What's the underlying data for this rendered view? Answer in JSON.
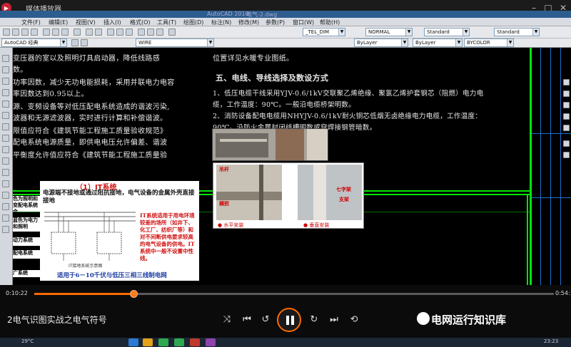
{
  "player": {
    "app_name": "媒体播放器",
    "video_title": "2电气识图实战之电气符号",
    "time_current": "0:10:22",
    "time_total": "0:54:17",
    "progress": 0.191,
    "watermark": "电网运行知识库"
  },
  "cad": {
    "app_title": "AutoCAD 2010",
    "doc_title": "电气-2.dwg",
    "menu": [
      "文件(F)",
      "编辑(E)",
      "视图(V)",
      "插入(I)",
      "格式(O)",
      "工具(T)",
      "绘图(D)",
      "标注(N)",
      "修改(M)",
      "参数(P)",
      "窗口(W)",
      "帮助(H)"
    ],
    "workspace": "AutoCAD 经典",
    "layer": "WIRE",
    "dimstyle": "_TEL_DIM",
    "style_normal": "NORMAL",
    "textstyle": "Standard",
    "tablestyle": "Standard",
    "linetype": "ByLayer",
    "lineweight": "ByLayer",
    "plotstyle": "BYCOLOR"
  },
  "drawing_text": {
    "left_lines": [
      "变压器的室以及照明灯具启动器，降低线路感",
      "数。",
      "功率因数，减少无功电能损耗，采用并联电力电容",
      "率因数达到0.95以上。",
      "源、变频设备等对低压配电系统造成的谐波污染,",
      "波器和无源滤波器，实时进行计算和补偿谐波。",
      "限值应符合《建筑节能工程施工质量验收规范》",
      "配电系统电源质量，即供电电压允许偏差、谐波",
      "平衡度允许值应符合《建筑节能工程施工质量验"
    ],
    "right_top": "位置详见水暖专业图纸。",
    "section_title": "五、电线、导线选择及数设方式",
    "item1_a": "1、低压电缆干线采用YJV-0.6/1kV交联聚乙烯绝缘、聚氯乙烯护套钢芯（阻燃）电力电",
    "item1_b": "缆，工作温度：90℃。一般沿电缆桥架明数。",
    "item2_a": "2、消防设备配电电缆用NHYJV-0.6/1kV耐火铜芯低烟无卤绝缘电力电缆，工作温度：",
    "item2_b": "90℃。沿防火金属封闭线槽明数或穿焊接钢管暗数。"
  },
  "side_labels": [
    "色为照明和变配电系统合",
    "蓝色为电力和照明",
    "动力系统",
    "配电系统",
    "广系统"
  ],
  "slide": {
    "title": "（1）IT系统",
    "desc": "电源端不接地或通过阻抗接地，电气设备的金属外壳直接接地",
    "note": "IT系统适用于用电环境较差的场所（如井下、化工厂、纺织厂等）和对不间断供电要求较高的电气设备的供电。IT系统中一般不设置中性线。",
    "caption": "IT接地系统示意图",
    "footer": "适用于6－10千伏与低压三相三线制电网"
  },
  "photos": {
    "label_a1": "吊杆",
    "label_a2": "横担",
    "label_b1": "七字架",
    "label_b2": "支架",
    "caption_a": "● 水平安装",
    "caption_b": "● 垂直安装"
  },
  "taskbar": {
    "weather": "29°C",
    "clock": "23:23"
  }
}
